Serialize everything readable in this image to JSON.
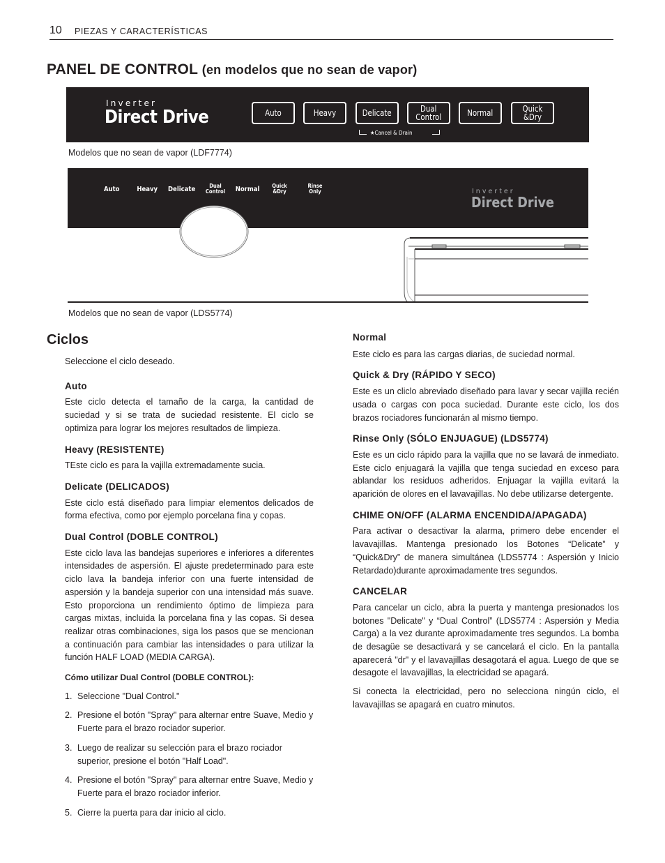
{
  "header": {
    "page_number": "10",
    "running_head": "PIEZAS Y CARACTERÍSTICAS"
  },
  "section": {
    "title": "PANEL DE CONTROL",
    "subtitle": "(en modelos que no sean de vapor)"
  },
  "panel_ldf7774": {
    "brand_small": "Inverter",
    "brand_big": "Direct Drive",
    "buttons": [
      {
        "label": "Auto"
      },
      {
        "label": "Heavy"
      },
      {
        "label": "Delicate"
      },
      {
        "label": "Dual\nControl"
      },
      {
        "label": "Normal"
      },
      {
        "label": "Quick\n&Dry"
      }
    ],
    "cancel_drain": "★Cancel & Drain",
    "caption": "Modelos que no sean de vapor (LDF7774)"
  },
  "panel_lds5774": {
    "labels": [
      {
        "label": "Auto"
      },
      {
        "label": "Heavy"
      },
      {
        "label": "Delicate"
      },
      {
        "label": "Dual\nControl"
      },
      {
        "label": "Normal"
      },
      {
        "label": "Quick\n&Dry"
      },
      {
        "label": "Rinse\nOnly"
      }
    ],
    "brand_small": "Inverter",
    "brand_big": "Direct Drive",
    "caption": "Modelos que no sean de vapor (LDS5774)"
  },
  "ciclos": {
    "title": "Ciclos",
    "intro": "Seleccione el ciclo deseado.",
    "left": [
      {
        "heading": "Auto",
        "text": "Este ciclo detecta el tamaño de la carga, la cantidad de suciedad y si se trata de suciedad resistente. El ciclo se optimiza para lograr los mejores resultados de limpieza."
      },
      {
        "heading": "Heavy (RESISTENTE)",
        "text": "TEste ciclo es para la vajilla extremadamente sucia."
      },
      {
        "heading": "Delicate (DELICADOS)",
        "text": "Este ciclo está diseñado para limpiar elementos delicados de forma efectiva, como por ejemplo porcelana fina y copas."
      },
      {
        "heading": "Dual Control (DOBLE CONTROL)",
        "text": "Este ciclo lava las bandejas superiores e inferiores a diferentes intensidades de aspersión. El ajuste predeterminado para este ciclo lava la bandeja inferior con una fuerte intensidad de aspersión y la bandeja superior con una intensidad más suave. Esto proporciona un rendimiento óptimo de limpieza para cargas mixtas, incluida la porcelana fina y las copas. Si desea realizar otras combinaciones, siga los pasos que se mencionan a continuación para cambiar las intensidades o para utilizar la función HALF LOAD (MEDIA CARGA)."
      }
    ],
    "howto": {
      "heading": "Cómo utilizar Dual Control (DOBLE CONTROL):",
      "steps": [
        {
          "n": "1.",
          "text": "Seleccione \"Dual Control.\""
        },
        {
          "n": "2.",
          "text": "Presione el botón \"Spray\" para alternar entre Suave, Medio y Fuerte para el brazo rociador superior."
        },
        {
          "n": "3.",
          "text": "Luego de realizar su selección para el brazo rociador superior, presione el botón \"Half Load\"."
        },
        {
          "n": "4.",
          "text": "Presione el botón \"Spray\" para alternar entre Suave, Medio y Fuerte para el brazo rociador inferior."
        },
        {
          "n": "5.",
          "text": "Cierre la puerta para dar inicio al ciclo."
        }
      ]
    },
    "right": [
      {
        "heading": "Normal",
        "text": "Este ciclo es para las cargas diarias, de suciedad normal."
      },
      {
        "heading": "Quick & Dry (RÁPIDO Y SECO)",
        "text": "Este es un cliclo abreviado diseñado para lavar y secar vajilla recién usada o cargas con poca suciedad. Durante este ciclo, los dos brazos rociadores funcionarán al mismo tiempo."
      },
      {
        "heading": "Rinse Only (SÓLO ENJUAGUE) (LDS5774)",
        "text": "Este es un ciclo rápido para la vajilla que no se lavará de inmediato. Este ciclo enjuagará la vajilla que tenga suciedad en exceso para ablandar los residuos adheridos. Enjuagar la vajilla evitará la aparición de olores en el lavavajillas. No debe utilizarse detergente."
      },
      {
        "heading": "CHIME ON/OFF (ALARMA ENCENDIDA/APAGADA)",
        "text": "Para activar o desactivar la alarma, primero debe encender el lavavajillas. Mantenga presionado los Botones “Delicate” y “Quick&Dry” de manera simultánea (LDS5774 : Aspersión y Inicio Retardado)durante aproximadamente tres segundos."
      },
      {
        "heading": "CANCELAR",
        "text": "Para cancelar un ciclo, abra la puerta y mantenga presionados los botones \"Delicate\" y “Dual Control” (LDS5774 : Aspersión y Media Carga) a la vez durante aproximadamente tres segundos. La bomba de desagüe se desactivará y se cancelará el ciclo. En la pantalla aparecerá \"dr\" y el lavavajillas desagotará el agua. Luego de que se desagote el lavavajillas, la electricidad se apagará."
      }
    ],
    "closing": "Si conecta la electricidad, pero no selecciona ningún ciclo, el lavavajillas se apagará en cuatro minutos."
  }
}
